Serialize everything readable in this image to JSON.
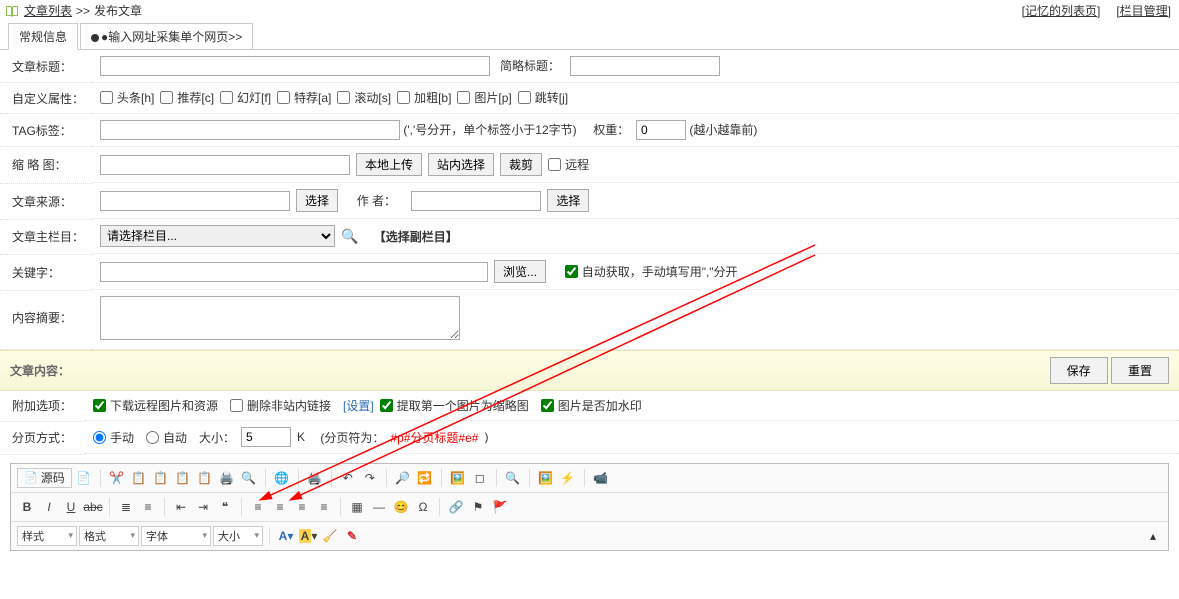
{
  "header": {
    "breadcrumb_1": "文章列表",
    "breadcrumb_sep": ">>",
    "breadcrumb_2": "发布文章",
    "link_memory": "[记忆的列表页]",
    "link_column_mgmt": "[栏目管理]"
  },
  "tabs": {
    "basic": "常规信息",
    "collect": "●输入网址采集单个网页>>"
  },
  "labels": {
    "title": "文章标题：",
    "short_title": "简略标题：",
    "attrs": "自定义属性：",
    "tags": "TAG标签：",
    "tags_hint": "(','号分开，单个标签小于12字节)",
    "weight": "权重：",
    "weight_value": "0",
    "weight_hint": "(越小越靠前)",
    "thumb": "缩 略 图：",
    "btn_local_upload": "本地上传",
    "btn_site_select": "站内选择",
    "btn_crop": "裁剪",
    "chk_remote": "远程",
    "source": "文章来源：",
    "btn_select": "选择",
    "author": "作    者：",
    "main_col": "文章主栏目：",
    "select_col_placeholder": "请选择栏目...",
    "sub_col_link": "【选择副栏目】",
    "keywords": "关键字：",
    "btn_browse": "浏览...",
    "keywords_hint": "自动获取，手动填写用\",\"分开",
    "summary": "内容摘要：",
    "content": "文章内容：",
    "btn_save": "保存",
    "btn_reset": "重置",
    "extra_opts": "附加选项：",
    "opt_dl_remote": "下载远程图片和资源",
    "opt_del_ext_link": "删除非站内链接",
    "opt_del_ext_link_cfg": "[设置]",
    "opt_extract_first": "提取第一个图片为缩略图",
    "opt_watermark": "图片是否加水印",
    "paging": "分页方式：",
    "page_manual": "手动",
    "page_auto": "自动",
    "page_size": "大小：",
    "page_size_value": "5",
    "page_unit": "K",
    "page_title_hint_pre": "(分页符为：",
    "page_title_hint_red": "#p#分页标题#e#",
    "page_title_hint_post": " )"
  },
  "attr_boxes": [
    {
      "key": "headline",
      "label": "头条[h]"
    },
    {
      "key": "recommend",
      "label": "推荐[c]"
    },
    {
      "key": "slide",
      "label": "幻灯[f]"
    },
    {
      "key": "special",
      "label": "特荐[a]"
    },
    {
      "key": "scroll",
      "label": "滚动[s]"
    },
    {
      "key": "bold",
      "label": "加粗[b]"
    },
    {
      "key": "image",
      "label": "图片[p]"
    },
    {
      "key": "jump",
      "label": "跳转[j]"
    }
  ],
  "editor": {
    "source": "源码",
    "style": "样式",
    "format": "格式",
    "font": "字体",
    "size": "大小"
  }
}
